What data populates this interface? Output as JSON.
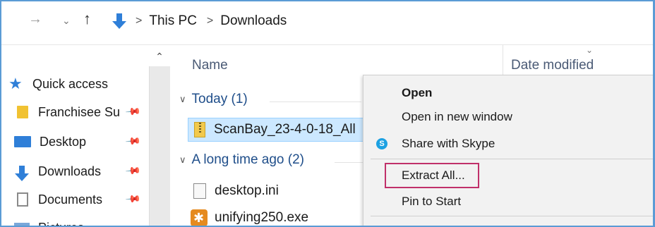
{
  "address": {
    "forward_glyph": "→",
    "history_glyph": "⌄",
    "up_glyph": "↑",
    "sep": ">",
    "crumbs": [
      "This PC",
      "Downloads"
    ]
  },
  "navpane": {
    "scroll_up_glyph": "⌃",
    "items": [
      {
        "label": "Quick access"
      },
      {
        "label": "Franchisee Su"
      },
      {
        "label": "Desktop"
      },
      {
        "label": "Downloads"
      },
      {
        "label": "Documents"
      },
      {
        "label": "Pictures"
      }
    ]
  },
  "filelist": {
    "columns": {
      "name": "Name",
      "date": "Date modified"
    },
    "sort_glyph": "⌄",
    "groups": [
      {
        "label": "Today (1)"
      },
      {
        "label": "A long time ago (2)"
      }
    ],
    "files": [
      {
        "name": "ScanBay_23-4-0-18_All"
      },
      {
        "name": "desktop.ini"
      },
      {
        "name": "unifying250.exe"
      }
    ]
  },
  "context_menu": {
    "items": [
      {
        "label": "Open"
      },
      {
        "label": "Open in new window"
      },
      {
        "label": "Share with Skype"
      },
      {
        "label": "Extract All..."
      },
      {
        "label": "Pin to Start"
      }
    ]
  },
  "colors": {
    "accent": "#2f7fd8",
    "highlight_box": "#c0306a",
    "selection": "#cce8ff"
  }
}
